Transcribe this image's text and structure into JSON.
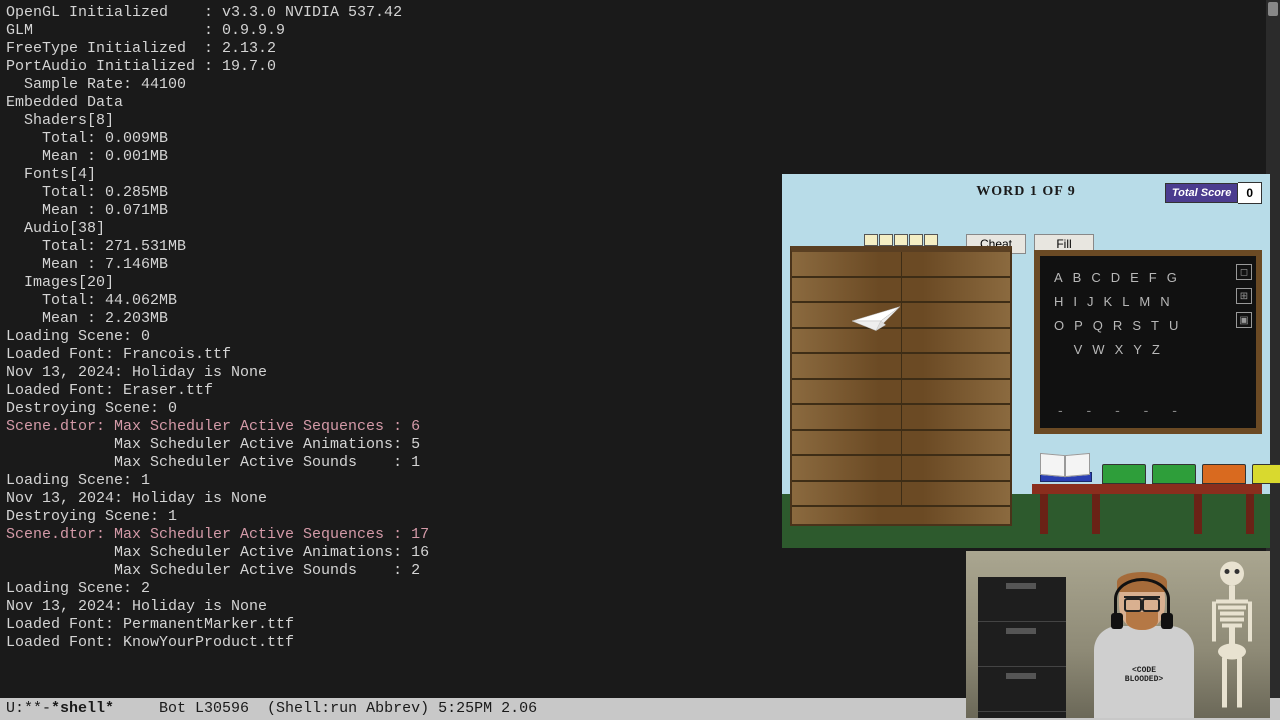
{
  "terminal": {
    "lines": [
      {
        "t": "OpenGL Initialized    : v3.3.0 NVIDIA 537.42"
      },
      {
        "t": "GLM                   : 0.9.9.9"
      },
      {
        "t": "FreeType Initialized  : 2.13.2"
      },
      {
        "t": "PortAudio Initialized : 19.7.0"
      },
      {
        "t": "  Sample Rate: 44100"
      },
      {
        "t": "Embedded Data"
      },
      {
        "t": "  Shaders[8]"
      },
      {
        "t": "    Total: 0.009MB"
      },
      {
        "t": "    Mean : 0.001MB"
      },
      {
        "t": "  Fonts[4]"
      },
      {
        "t": "    Total: 0.285MB"
      },
      {
        "t": "    Mean : 0.071MB"
      },
      {
        "t": "  Audio[38]"
      },
      {
        "t": "    Total: 271.531MB"
      },
      {
        "t": "    Mean : 7.146MB"
      },
      {
        "t": "  Images[20]"
      },
      {
        "t": "    Total: 44.062MB"
      },
      {
        "t": "    Mean : 2.203MB"
      },
      {
        "t": "Loading Scene: 0"
      },
      {
        "t": "Loaded Font: Francois.ttf"
      },
      {
        "t": "Nov 13, 2024: Holiday is None"
      },
      {
        "t": "Loaded Font: Eraser.ttf"
      },
      {
        "t": "Destroying Scene: 0"
      },
      {
        "t": "Scene.dtor: Max Scheduler Active Sequences : 6",
        "c": "pink"
      },
      {
        "t": "            Max Scheduler Active Animations: 5"
      },
      {
        "t": "            Max Scheduler Active Sounds    : 1"
      },
      {
        "t": "Loading Scene: 1"
      },
      {
        "t": "Nov 13, 2024: Holiday is None"
      },
      {
        "t": "Destroying Scene: 1"
      },
      {
        "t": "Scene.dtor: Max Scheduler Active Sequences : 17",
        "c": "pink"
      },
      {
        "t": "            Max Scheduler Active Animations: 16"
      },
      {
        "t": "            Max Scheduler Active Sounds    : 2"
      },
      {
        "t": "Loading Scene: 2"
      },
      {
        "t": "Nov 13, 2024: Holiday is None"
      },
      {
        "t": "Loaded Font: PermanentMarker.ttf"
      },
      {
        "t": "Loaded Font: KnowYourProduct.ttf"
      },
      {
        "t": ""
      }
    ]
  },
  "statusbar": {
    "left": "U:**-",
    "buffer": "*shell*",
    "right": "     Bot L30596  (Shell:run Abbrev) 5:25PM 2.06"
  },
  "game": {
    "word_header": "WORD 1 OF 9",
    "total_score_label": "Total Score",
    "total_score_value": "0",
    "cheat_label": "Cheat",
    "fill_label": "Fill",
    "top_boxes": 5,
    "letters_rows": [
      [
        "A",
        "B",
        "C",
        "D",
        "E",
        "F",
        "G"
      ],
      [
        "H",
        "I",
        "J",
        "K",
        "L",
        "M",
        "N"
      ],
      [
        "O",
        "P",
        "Q",
        "R",
        "S",
        "T",
        "U"
      ],
      [
        "V",
        "W",
        "X",
        "Y",
        "Z"
      ]
    ],
    "dashes": "-   -   -   -   -",
    "book_colors": [
      "#2e9e3a",
      "#2e9e3a",
      "#d96a1f",
      "#d9d92e"
    ]
  },
  "webcam": {
    "shirt_text": "<CODE BLOODED>"
  }
}
